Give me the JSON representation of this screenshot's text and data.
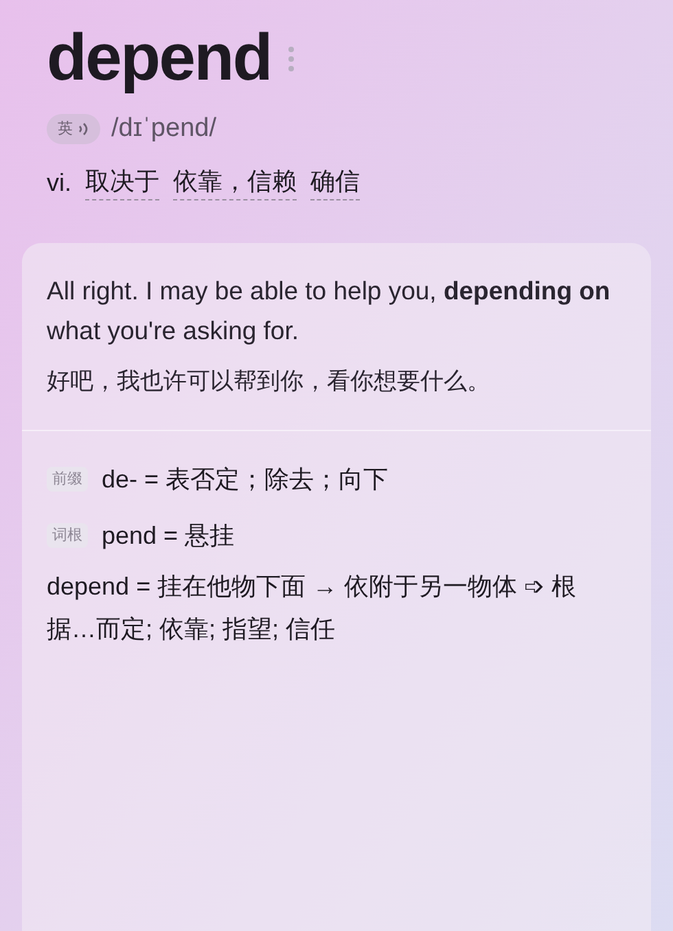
{
  "word": "depend",
  "pronunciation": {
    "accent": "英",
    "phonetic": "/dɪˈpend/"
  },
  "definition": {
    "pos": "vi.",
    "meanings": [
      "取决于",
      "依靠，信赖",
      "确信"
    ]
  },
  "example": {
    "english": "All right. I may be able to help you, **depending on** what you're asking for.",
    "chinese": "好吧，我也许可以帮到你，看你想要什么。"
  },
  "etymology": {
    "parts": [
      {
        "tag": "前缀",
        "text": "de- = 表否定；除去；向下"
      },
      {
        "tag": "词根",
        "text": "pend = 悬挂"
      }
    ],
    "explanation": "depend = 挂在他物下面 → 依附于另一物体  ➩ 根据…而定; 依靠; 指望; 信任"
  }
}
